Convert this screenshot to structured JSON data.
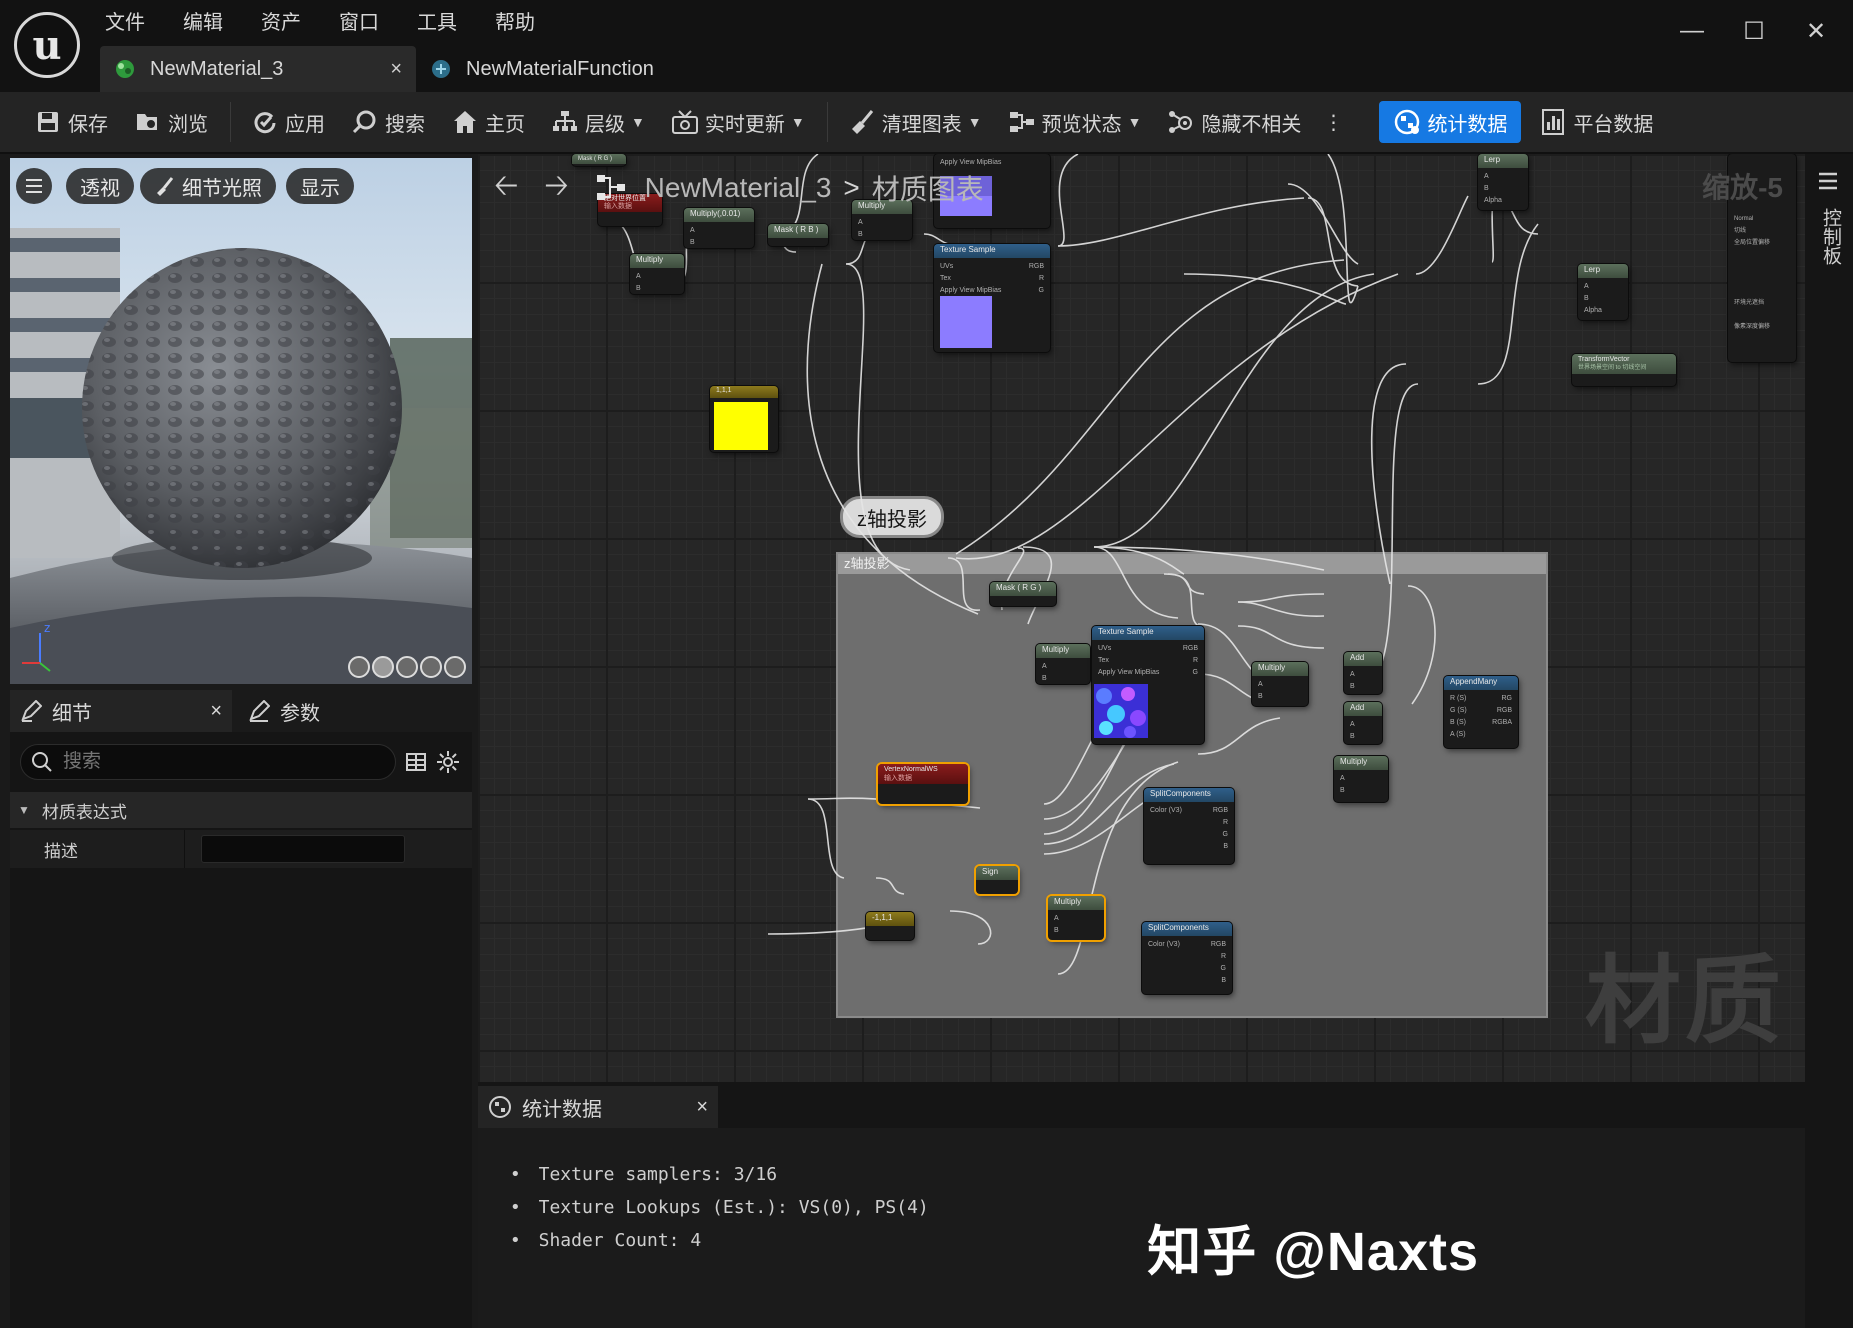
{
  "menu": [
    "文件",
    "编辑",
    "资产",
    "窗口",
    "工具",
    "帮助"
  ],
  "window_controls": {
    "minimize": "—",
    "maximize": "☐",
    "close": "✕"
  },
  "tabs": [
    {
      "label": "NewMaterial_3",
      "close": "×"
    },
    {
      "label": "NewMaterialFunction"
    }
  ],
  "toolbar": {
    "save": "保存",
    "browse": "浏览",
    "apply": "应用",
    "search": "搜索",
    "home": "主页",
    "hierarchy": "层级",
    "live_update": "实时更新",
    "clean_graph": "清理图表",
    "preview_state": "预览状态",
    "hide_unrelated": "隐藏不相关",
    "more": "⋮",
    "stats": "统计数据",
    "platform_stats": "平台数据"
  },
  "viewport": {
    "perspective": "透视",
    "lit": "细节光照",
    "show": "显示"
  },
  "details": {
    "tab_details": "细节",
    "tab_params": "参数",
    "close": "×",
    "search_placeholder": "搜索",
    "section": "材质表达式",
    "desc_label": "描述"
  },
  "graph": {
    "breadcrumb_root": "NewMaterial_3",
    "breadcrumb_sep": ">",
    "breadcrumb_leaf": "材质图表",
    "zoom": "缩放-5",
    "watermark": "材质",
    "comment": "z轴投影",
    "control_panel": "控制板",
    "nodes": {
      "abs_world_pos": "绝对世界位置",
      "abs_world_pos_sub": "输入数据",
      "mul_001": "Multiply(,0.01)",
      "mask_rb": "Mask ( R B )",
      "mask_rg": "Mask ( R G )",
      "multiply": "Multiply",
      "lerp": "Lerp",
      "tex_sample": "Texture Sample",
      "transform_vector": "TransformVector",
      "transform_sub": "世界场景空间 to 切线空间",
      "const_111": "1,1,1",
      "vertex_normal": "VertexNormalWS",
      "vertex_normal_sub": "输入数据",
      "sign": "Sign",
      "split": "SplitComponents",
      "add": "Add",
      "append": "AppendMany",
      "const_m111": "-1,1,1",
      "pin_a": "A",
      "pin_b": "B",
      "pin_alpha": "Alpha",
      "pin_uvs": "UVs",
      "pin_tex": "Tex",
      "pin_mip": "Apply View MipBias",
      "pin_rgb": "RGB",
      "pin_r": "R",
      "pin_g": "G",
      "pin_b2": "B",
      "pin_a2": "A",
      "pin_rgba": "RGBA",
      "pin_color": "Color (V3)",
      "pin_rs": "R (S)",
      "pin_gs": "G (S)",
      "pin_bs": "B (S)",
      "pin_as": "A (S)",
      "pin_rg": "RG",
      "mat_normal": "Normal",
      "mat_tangent": "切线",
      "mat_world_offset": "全局位置偏移",
      "mat_ao": "环境光遮挡",
      "mat_pixel_depth": "像素深度偏移"
    }
  },
  "stats": {
    "tab": "统计数据",
    "close": "×",
    "lines": [
      "Texture samplers: 3/16",
      "Texture Lookups (Est.): VS(0), PS(4)",
      "Shader Count: 4"
    ]
  },
  "overlay": {
    "zhihu": "知乎 @Naxts"
  },
  "colors": {
    "accent": "#1679e3",
    "yellow_const": "#ffff00",
    "purple_tex": "#8c7cff",
    "selection": "#f0a000"
  }
}
